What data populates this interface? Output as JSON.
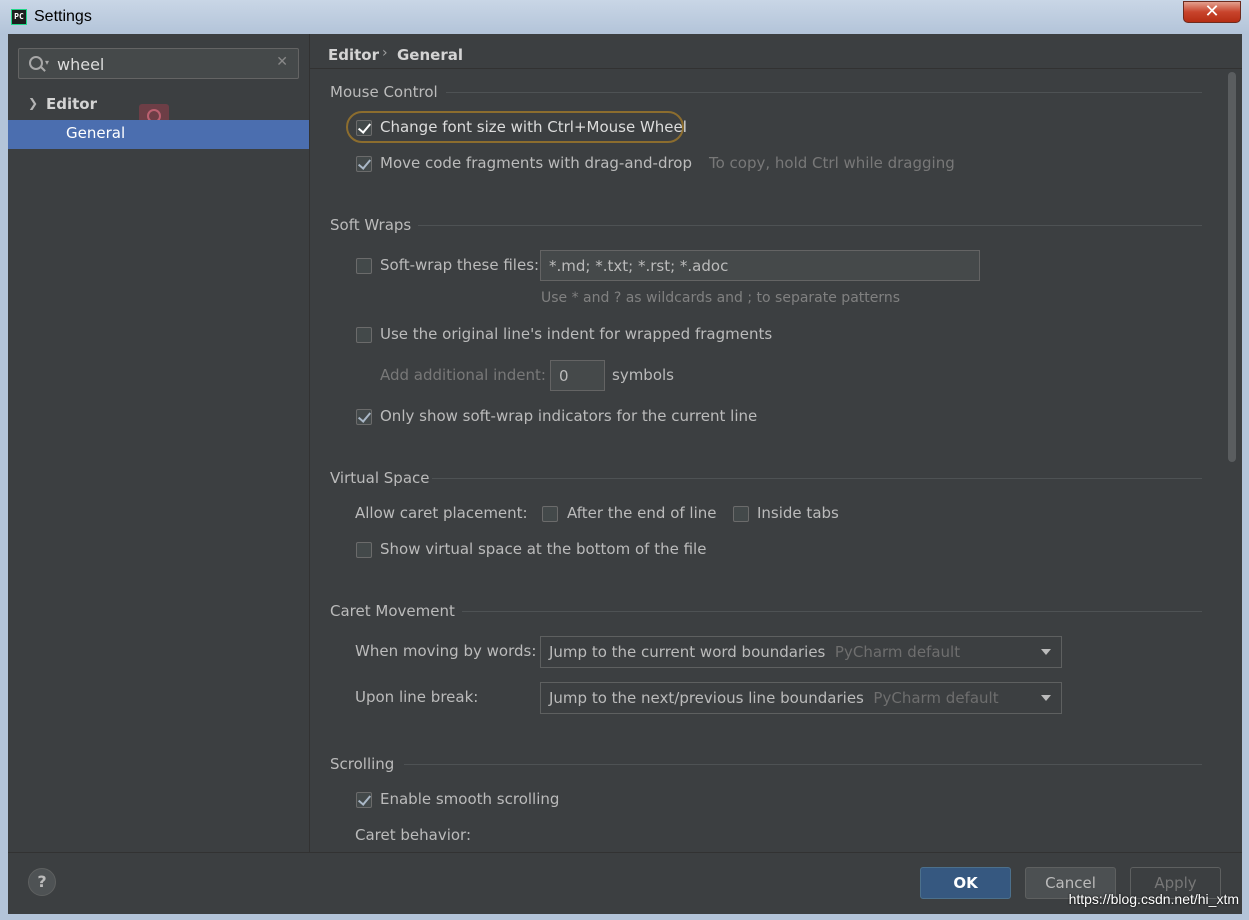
{
  "window": {
    "title": "Settings",
    "close_glyph": "✕",
    "app_icon": "PC"
  },
  "sidebar": {
    "search_value": "wheel",
    "tree": {
      "editor_label": "Editor",
      "general_label": "General"
    }
  },
  "breadcrumb": {
    "parent": "Editor",
    "separator": "›",
    "current": "General"
  },
  "mouse_control": {
    "title": "Mouse Control",
    "ctrl_wheel": "Change font size with Ctrl+Mouse Wheel",
    "drag_drop": "Move code fragments with drag-and-drop",
    "drag_drop_hint": "To copy, hold Ctrl while dragging"
  },
  "soft_wraps": {
    "title": "Soft Wraps",
    "softwrap_files_label": "Soft-wrap these files:",
    "softwrap_files_value": "*.md; *.txt; *.rst; *.adoc",
    "softwrap_hint": "Use * and ? as wildcards and ; to separate patterns",
    "original_indent": "Use the original line's indent for wrapped fragments",
    "additional_indent_label": "Add additional indent:",
    "additional_indent_value": "0",
    "symbols_label": "symbols",
    "indicators": "Only show soft-wrap indicators for the current line"
  },
  "virtual_space": {
    "title": "Virtual Space",
    "caret_placement_label": "Allow caret placement:",
    "after_end": "After the end of line",
    "inside_tabs": "Inside tabs",
    "bottom_space": "Show virtual space at the bottom of the file"
  },
  "caret_movement": {
    "title": "Caret Movement",
    "words_label": "When moving by words:",
    "words_value": "Jump to the current word boundaries",
    "words_default": "PyCharm default",
    "linebreak_label": "Upon line break:",
    "linebreak_value": "Jump to the next/previous line boundaries",
    "linebreak_default": "PyCharm default"
  },
  "scrolling": {
    "title": "Scrolling",
    "smooth": "Enable smooth scrolling",
    "caret_behavior": "Caret behavior:"
  },
  "footer": {
    "help": "?",
    "ok": "OK",
    "cancel": "Cancel",
    "apply": "Apply"
  },
  "watermark": "https://blog.csdn.net/hi_xtm",
  "colors": {
    "selection": "#4b6eaf",
    "ok_button": "#365880",
    "focus_ring": "#8c6d2e",
    "background": "#3c3f41"
  }
}
